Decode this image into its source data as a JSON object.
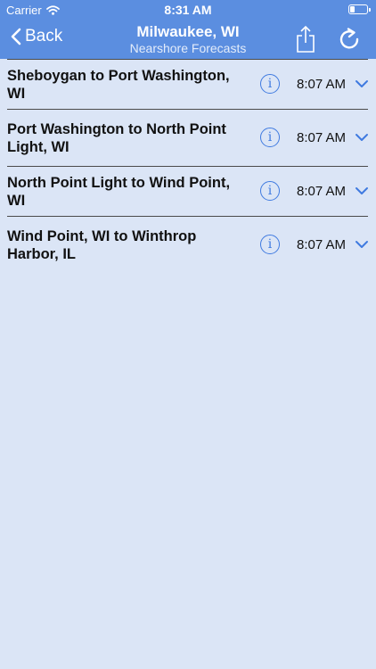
{
  "status_bar": {
    "carrier": "Carrier",
    "time": "8:31 AM",
    "battery_level": 0.3
  },
  "nav": {
    "back_label": "Back",
    "title": "Milwaukee, WI",
    "subtitle": "Nearshore Forecasts"
  },
  "forecasts": [
    {
      "name": "Sheboygan to Port Washington, WI",
      "time": "8:07 AM"
    },
    {
      "name": "Port Washington to North Point Light, WI",
      "time": "8:07 AM"
    },
    {
      "name": "North Point Light to Wind Point, WI",
      "time": "8:07 AM"
    },
    {
      "name": "Wind Point, WI to Winthrop Harbor, IL",
      "time": "8:07 AM"
    }
  ],
  "colors": {
    "header": "#5b8ee0",
    "background": "#dbe5f6",
    "accent": "#3f7ae0"
  },
  "icons": {
    "info": "i"
  }
}
